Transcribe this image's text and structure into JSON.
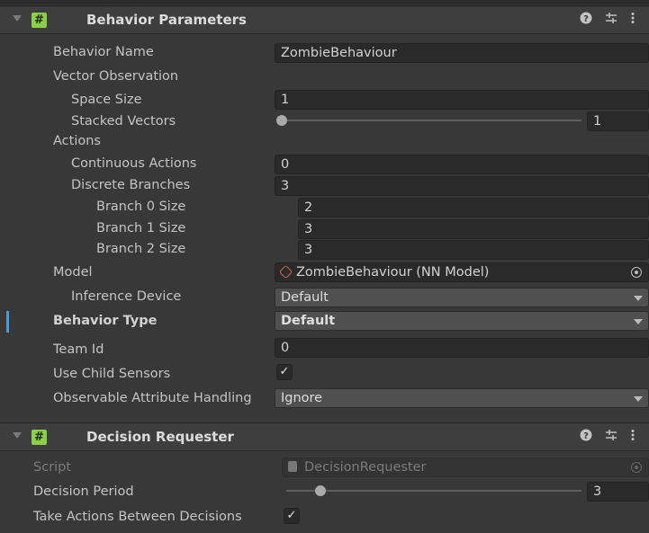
{
  "behavior_parameters": {
    "title": "Behavior Parameters",
    "behavior_name": {
      "label": "Behavior Name",
      "value": "ZombieBehaviour"
    },
    "vector_observation": {
      "label": "Vector Observation"
    },
    "space_size": {
      "label": "Space Size",
      "value": "1"
    },
    "stacked_vectors": {
      "label": "Stacked Vectors",
      "value": "1",
      "slider_fraction": 0.0
    },
    "actions": {
      "label": "Actions"
    },
    "continuous_actions": {
      "label": "Continuous Actions",
      "value": "0"
    },
    "discrete_branches": {
      "label": "Discrete Branches",
      "value": "3"
    },
    "branches": [
      {
        "label": "Branch 0 Size",
        "value": "2"
      },
      {
        "label": "Branch 1 Size",
        "value": "3"
      },
      {
        "label": "Branch 2 Size",
        "value": "3"
      }
    ],
    "model": {
      "label": "Model",
      "value": "ZombieBehaviour (NN Model)"
    },
    "inference_device": {
      "label": "Inference Device",
      "value": "Default"
    },
    "behavior_type": {
      "label": "Behavior Type",
      "value": "Default"
    },
    "team_id": {
      "label": "Team Id",
      "value": "0"
    },
    "use_child_sensors": {
      "label": "Use Child Sensors",
      "checked": true,
      "check_glyph": "✓"
    },
    "observable_attribute_handling": {
      "label": "Observable Attribute Handling",
      "value": "Ignore"
    }
  },
  "decision_requester": {
    "title": "Decision Requester",
    "script": {
      "label": "Script",
      "value": "DecisionRequester"
    },
    "decision_period": {
      "label": "Decision Period",
      "value": "3",
      "slider_fraction": 0.12
    },
    "take_actions": {
      "label": "Take Actions Between Decisions",
      "checked": true,
      "check_glyph": "✓"
    }
  },
  "header_icons": {
    "script": "#",
    "help": "❓",
    "presets": "⇄",
    "menu": "⋮"
  },
  "colors": {
    "script_icon": "#8ccf4d",
    "focus_accent": "#4c9ad8",
    "model_icon": "#d06a4a"
  }
}
